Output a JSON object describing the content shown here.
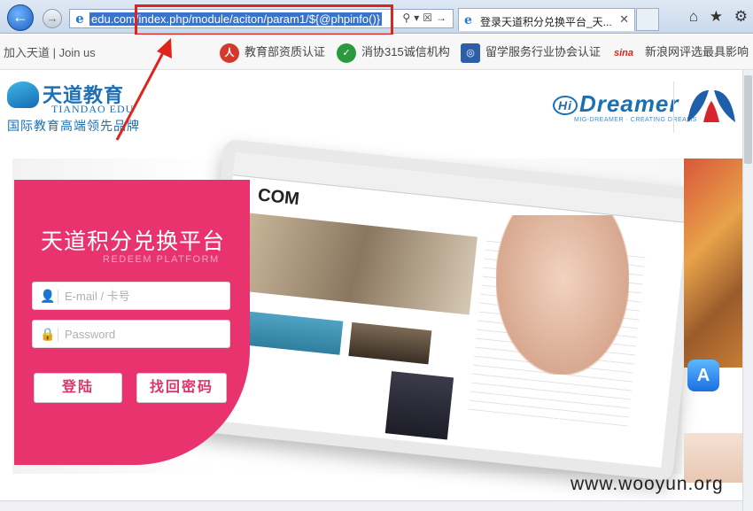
{
  "browser": {
    "address_url": "edu.com/index.php/module/aciton/param1/${@phpinfo()}",
    "address_url_prefix": "edu.com",
    "address_url_rest": "/index.php/module/aciton/param1/${@phpinfo()}",
    "tab_title": "登录天道积分兑换平台_天...",
    "back_icon": "back-arrow-icon",
    "forward_icon": "forward-arrow-icon",
    "tools": {
      "home": "⌂",
      "favorites": "★",
      "settings": "⚙"
    }
  },
  "topbar": {
    "join_text": "加入天道 | Join us",
    "certs": [
      {
        "label": "教育部资质认证",
        "icon": "ministry-seal-icon",
        "color": "#d33a2c"
      },
      {
        "label": "消协315诚信机构",
        "icon": "consumer-association-icon",
        "color": "#2b9a3e"
      },
      {
        "label": "留学服务行业协会认证",
        "icon": "association-badge-icon",
        "color": "#2d5ea8"
      },
      {
        "label": "新浪网评选最具影响",
        "icon": "sina-logo-icon",
        "color": "#e2231a"
      }
    ]
  },
  "header": {
    "logo_cn": "天道教育",
    "logo_en": "TIANDAO EDU",
    "slogan": "国际教育高端领先品牌",
    "partner_logo": "Hi Dreamer",
    "partner_sub": "MIG-DREAMER · CREATING DREAMS",
    "brand_color": "#1d6fb6"
  },
  "login": {
    "title": "天道积分兑换平台",
    "subtitle": "REDEEM PLATFORM",
    "email_placeholder": "E-mail / 卡号",
    "password_placeholder": "Password",
    "login_button": "登陆",
    "forgot_button": "找回密码",
    "panel_color": "#e8336f"
  },
  "watermark": "www.wooyun.org"
}
